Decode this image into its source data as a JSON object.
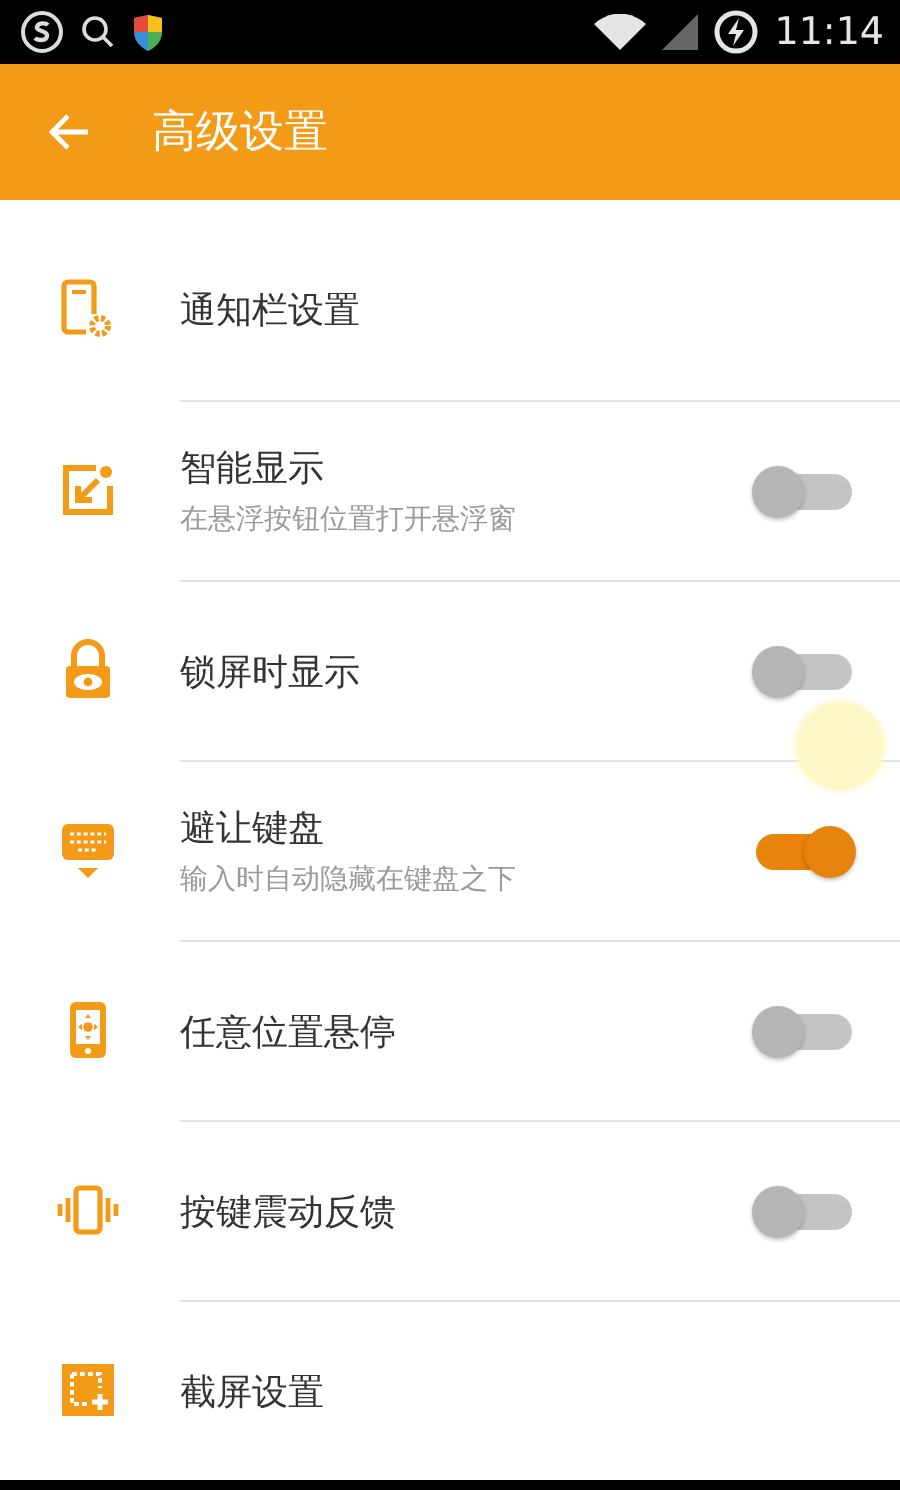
{
  "status_bar": {
    "time": "11:14"
  },
  "app_bar": {
    "title": "高级设置"
  },
  "settings": [
    {
      "kind": "link",
      "title": "通知栏设置"
    },
    {
      "kind": "toggle",
      "title": "智能显示",
      "subtitle": "在悬浮按钮位置打开悬浮窗",
      "on": false
    },
    {
      "kind": "toggle",
      "title": "锁屏时显示",
      "on": false
    },
    {
      "kind": "toggle",
      "title": "避让键盘",
      "subtitle": "输入时自动隐藏在键盘之下",
      "on": true
    },
    {
      "kind": "toggle",
      "title": "任意位置悬停",
      "on": false
    },
    {
      "kind": "toggle",
      "title": "按键震动反馈",
      "on": false
    },
    {
      "kind": "link",
      "title": "截屏设置"
    }
  ]
}
